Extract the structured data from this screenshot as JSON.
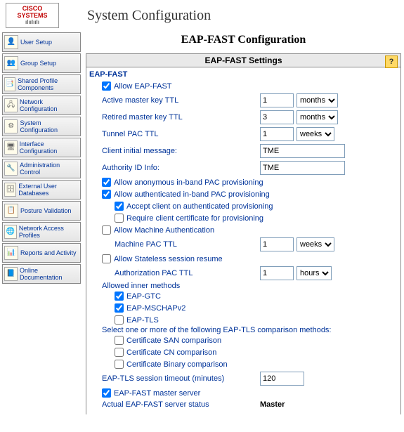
{
  "branding": {
    "logo_text": "CISCO SYSTEMS",
    "page_title": "System Configuration"
  },
  "subpage_title": "EAP-FAST Configuration",
  "sidebar": {
    "items": [
      {
        "label": "User Setup"
      },
      {
        "label": "Group Setup"
      },
      {
        "label": "Shared Profile Components"
      },
      {
        "label": "Network Configuration"
      },
      {
        "label": "System Configuration"
      },
      {
        "label": "Interface Configuration"
      },
      {
        "label": "Administration Control"
      },
      {
        "label": "External User Databases"
      },
      {
        "label": "Posture Validation"
      },
      {
        "label": "Network Access Profiles"
      },
      {
        "label": "Reports and Activity"
      },
      {
        "label": "Online Documentation"
      }
    ]
  },
  "section": {
    "header": "EAP-FAST Settings",
    "help_label": "?",
    "group_title": "EAP-FAST",
    "allow_eapfast": {
      "checked": true,
      "label": "Allow EAP-FAST"
    },
    "active_ttl": {
      "label": "Active master key TTL",
      "value": "1",
      "unit": "months"
    },
    "retired_ttl": {
      "label": "Retired master key TTL",
      "value": "3",
      "unit": "months"
    },
    "tunnel_pac_ttl": {
      "label": "Tunnel PAC TTL",
      "value": "1",
      "unit": "weeks"
    },
    "client_initial": {
      "label": "Client initial message:",
      "value": "TME"
    },
    "authority_id": {
      "label": "Authority ID Info:",
      "value": "TME"
    },
    "allow_anon_pac": {
      "checked": true,
      "label": "Allow anonymous in-band PAC provisioning"
    },
    "allow_auth_pac": {
      "checked": true,
      "label": "Allow authenticated in-band PAC provisioning"
    },
    "accept_client_auth": {
      "checked": true,
      "label": "Accept client on authenticated provisioning"
    },
    "require_client_cert": {
      "checked": false,
      "label": "Require client certificate for provisioning"
    },
    "allow_machine_auth": {
      "checked": false,
      "label": "Allow Machine Authentication"
    },
    "machine_pac_ttl": {
      "label": "Machine PAC TTL",
      "value": "1",
      "unit": "weeks"
    },
    "allow_stateless": {
      "checked": false,
      "label": "Allow Stateless session resume"
    },
    "auth_pac_ttl": {
      "label": "Authorization PAC TTL",
      "value": "1",
      "unit": "hours"
    },
    "allowed_inner_header": "Allowed inner methods",
    "inner_eap_gtc": {
      "checked": true,
      "label": "EAP-GTC"
    },
    "inner_eap_mschap": {
      "checked": true,
      "label": "EAP-MSCHAPv2"
    },
    "inner_eap_tls": {
      "checked": false,
      "label": "EAP-TLS"
    },
    "eaptls_compare_header": "Select one or more of the following EAP-TLS comparison methods:",
    "cert_san": {
      "checked": false,
      "label": "Certificate SAN comparison"
    },
    "cert_cn": {
      "checked": false,
      "label": "Certificate CN comparison"
    },
    "cert_bin": {
      "checked": false,
      "label": "Certificate Binary comparison"
    },
    "session_timeout": {
      "label": "EAP-TLS session timeout (minutes)",
      "value": "120"
    },
    "master_server": {
      "checked": true,
      "label": "EAP-FAST master server"
    },
    "actual_status": {
      "label": "Actual EAP-FAST server status",
      "value": "Master"
    }
  }
}
